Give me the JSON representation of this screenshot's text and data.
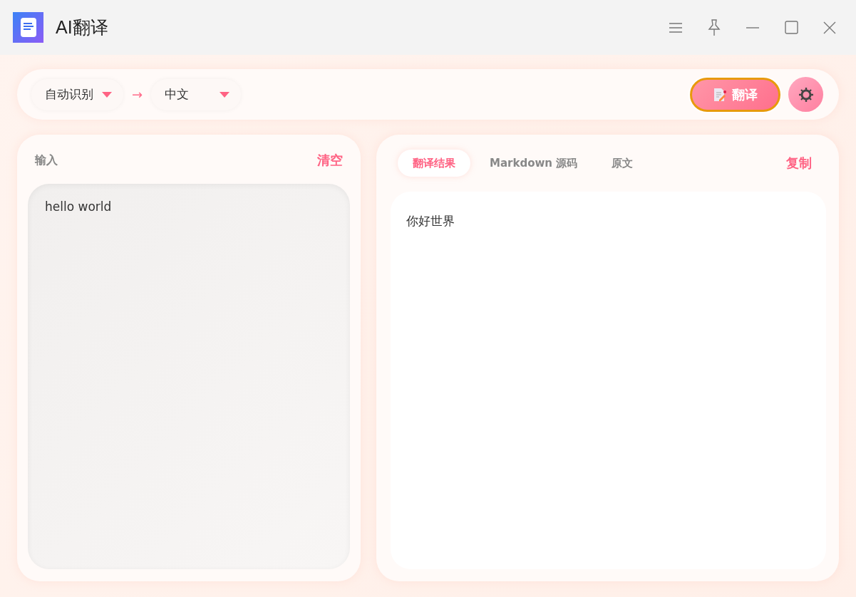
{
  "window": {
    "title": "AI翻译"
  },
  "toolbar": {
    "source_language": "自动识别",
    "arrow": "→",
    "target_language": "中文",
    "translate_button": "翻译"
  },
  "input_panel": {
    "label": "输入",
    "clear_button": "清空",
    "value": "hello world"
  },
  "output_panel": {
    "tabs": [
      {
        "label": "翻译结果",
        "selected": true
      },
      {
        "label": "Markdown 源码",
        "selected": false
      },
      {
        "label": "原文",
        "selected": false
      }
    ],
    "copy_button": "复制",
    "result": "你好世界"
  }
}
